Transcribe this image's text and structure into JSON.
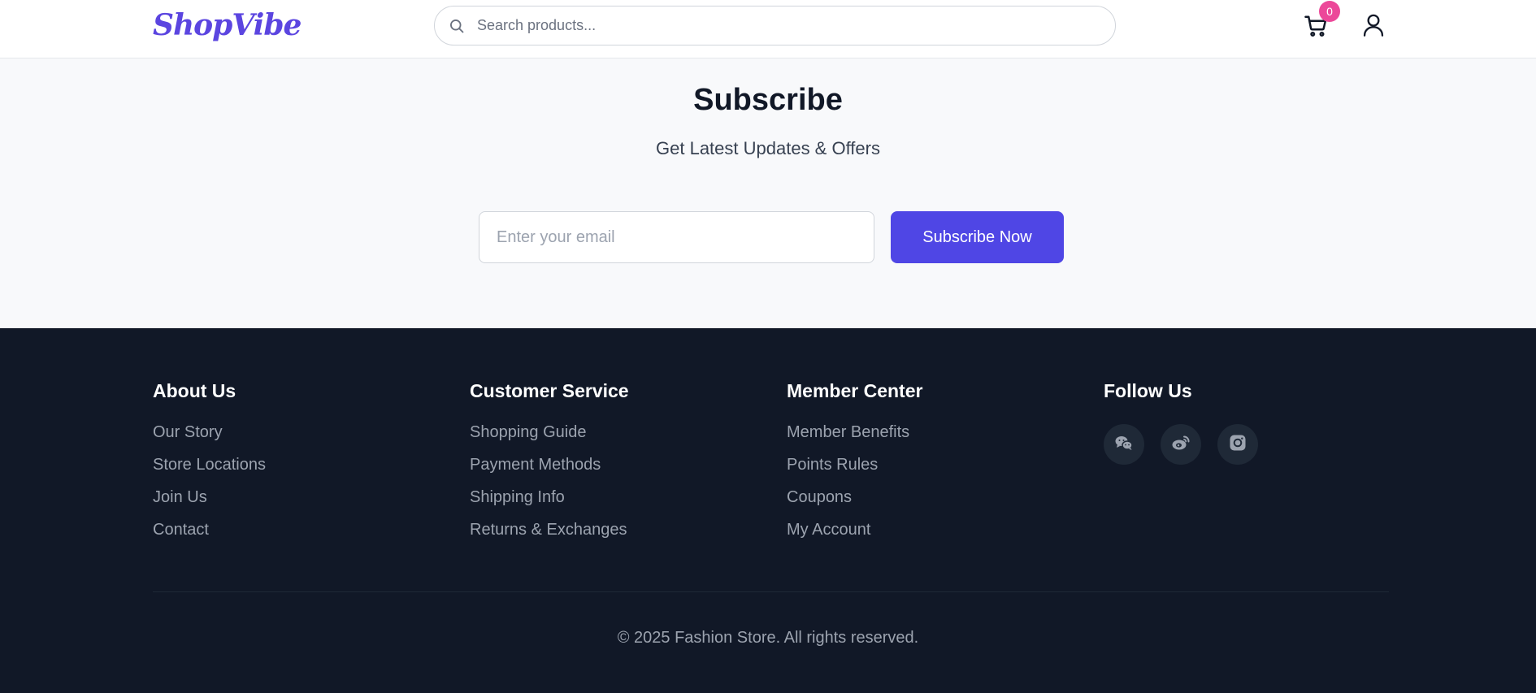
{
  "header": {
    "logo": "ShopVibe",
    "search": {
      "placeholder": "Search products..."
    },
    "cart": {
      "count": "0",
      "icon": "cart-icon"
    },
    "user_icon": "user-icon",
    "search_icon": "search-icon"
  },
  "subscribe": {
    "title": "Subscribe",
    "subtitle": "Get Latest Updates & Offers",
    "email_placeholder": "Enter your email",
    "button_label": "Subscribe Now"
  },
  "footer": {
    "columns": [
      {
        "title": "About Us",
        "items": [
          "Our Story",
          "Store Locations",
          "Join Us",
          "Contact"
        ]
      },
      {
        "title": "Customer Service",
        "items": [
          "Shopping Guide",
          "Payment Methods",
          "Shipping Info",
          "Returns & Exchanges"
        ]
      },
      {
        "title": "Member Center",
        "items": [
          "Member Benefits",
          "Points Rules",
          "Coupons",
          "My Account"
        ]
      }
    ],
    "follow": {
      "title": "Follow Us",
      "icons": [
        "wechat-icon",
        "weibo-icon",
        "instagram-icon"
      ]
    },
    "copyright": "© 2025 Fashion Store. All rights reserved."
  },
  "colors": {
    "brand": "#5b45e0",
    "button": "#4f46e5",
    "badge": "#ec4899",
    "footer_bg": "#111827"
  }
}
